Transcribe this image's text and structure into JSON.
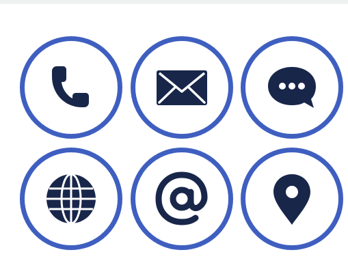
{
  "colors": {
    "ring": "#3f5fc0",
    "glyph": "#18264a",
    "background": "#ffffff",
    "top_edge": "#eef2f1"
  },
  "icons": [
    {
      "id": "phone",
      "icon": "phone-icon"
    },
    {
      "id": "email",
      "icon": "envelope-icon"
    },
    {
      "id": "chat",
      "icon": "chat-bubble-icon"
    },
    {
      "id": "web",
      "icon": "globe-icon"
    },
    {
      "id": "at",
      "icon": "at-sign-icon"
    },
    {
      "id": "location",
      "icon": "location-pin-icon"
    }
  ]
}
